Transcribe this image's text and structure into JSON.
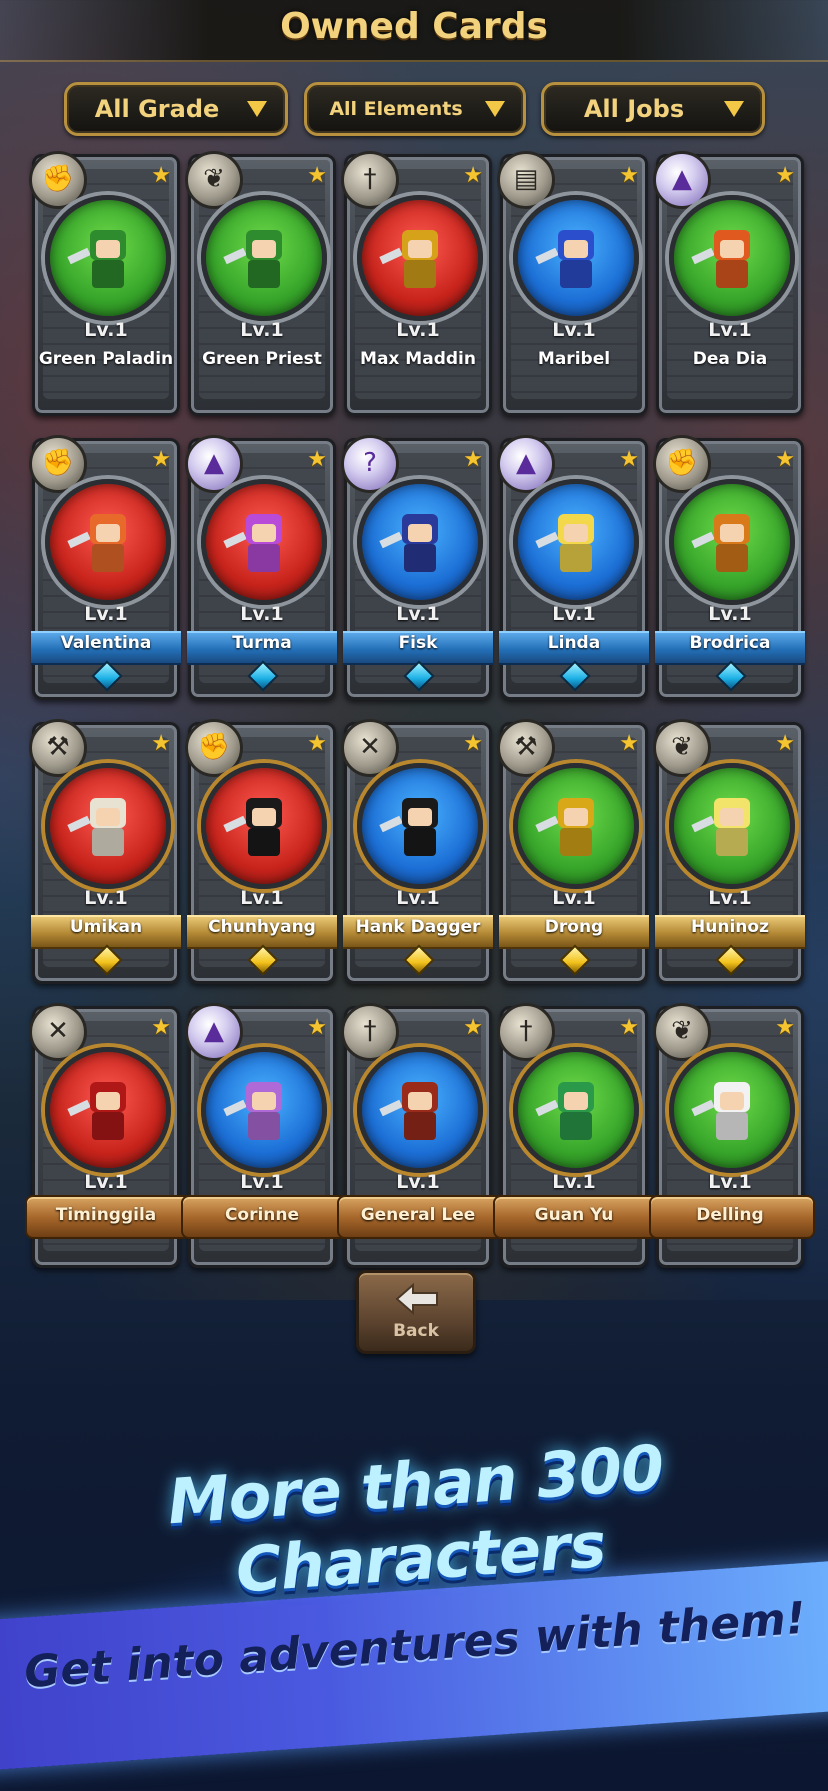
{
  "header": {
    "title": "Owned Cards"
  },
  "filters": {
    "grade": "All Grade",
    "elements": "All Elements",
    "jobs": "All Jobs"
  },
  "cards": [
    {
      "name": "Green Paladin",
      "level": "Lv.1",
      "job_icon": "fist-icon",
      "element": "green",
      "frame": "plain"
    },
    {
      "name": "Green Priest",
      "level": "Lv.1",
      "job_icon": "wings-icon",
      "element": "green",
      "frame": "plain"
    },
    {
      "name": "Max Maddin",
      "level": "Lv.1",
      "job_icon": "sword-icon",
      "element": "red",
      "frame": "plain"
    },
    {
      "name": "Maribel",
      "level": "Lv.1",
      "job_icon": "book-icon",
      "element": "blue",
      "frame": "plain"
    },
    {
      "name": "Dea Dia",
      "level": "Lv.1",
      "job_icon": "witch-hat-icon",
      "element": "green",
      "frame": "plain"
    },
    {
      "name": "Valentina",
      "level": "Lv.1",
      "job_icon": "fist-icon",
      "element": "red",
      "frame": "blue"
    },
    {
      "name": "Turma",
      "level": "Lv.1",
      "job_icon": "witch-hat-icon",
      "element": "red",
      "frame": "blue"
    },
    {
      "name": "Fisk",
      "level": "Lv.1",
      "job_icon": "spirit-icon",
      "element": "blue",
      "frame": "blue"
    },
    {
      "name": "Linda",
      "level": "Lv.1",
      "job_icon": "witch-hat-icon",
      "element": "blue",
      "frame": "blue"
    },
    {
      "name": "Brodrica",
      "level": "Lv.1",
      "job_icon": "fist-icon",
      "element": "green",
      "frame": "blue"
    },
    {
      "name": "Umikan",
      "level": "Lv.1",
      "job_icon": "axe-icon",
      "element": "red",
      "frame": "gold"
    },
    {
      "name": "Chunhyang",
      "level": "Lv.1",
      "job_icon": "fist-icon",
      "element": "red",
      "frame": "gold"
    },
    {
      "name": "Hank Dagger",
      "level": "Lv.1",
      "job_icon": "crossed-swords-icon",
      "element": "blue",
      "frame": "gold"
    },
    {
      "name": "Drong",
      "level": "Lv.1",
      "job_icon": "axe-icon",
      "element": "green",
      "frame": "gold"
    },
    {
      "name": "Huninoz",
      "level": "Lv.1",
      "job_icon": "wings-icon",
      "element": "green",
      "frame": "gold"
    },
    {
      "name": "Timinggila",
      "level": "Lv.1",
      "job_icon": "crossed-swords-icon",
      "element": "red",
      "frame": "laurel"
    },
    {
      "name": "Corinne",
      "level": "Lv.1",
      "job_icon": "witch-hat-icon",
      "element": "blue",
      "frame": "laurel"
    },
    {
      "name": "General Lee",
      "level": "Lv.1",
      "job_icon": "sword-icon",
      "element": "blue",
      "frame": "laurel"
    },
    {
      "name": "Guan Yu",
      "level": "Lv.1",
      "job_icon": "sword-icon",
      "element": "green",
      "frame": "laurel"
    },
    {
      "name": "Delling",
      "level": "Lv.1",
      "job_icon": "wings-icon",
      "element": "green",
      "frame": "laurel"
    }
  ],
  "back_button": {
    "label": "Back",
    "icon": "back-arrow-icon"
  },
  "promo": {
    "headline": "More than 300 Characters",
    "subline": "Get into adventures with them!"
  },
  "colors": {
    "accent_gold": "#f3d27e",
    "element_green": "#37a52a",
    "element_red": "#c8241c",
    "element_blue": "#1c6fd6"
  }
}
